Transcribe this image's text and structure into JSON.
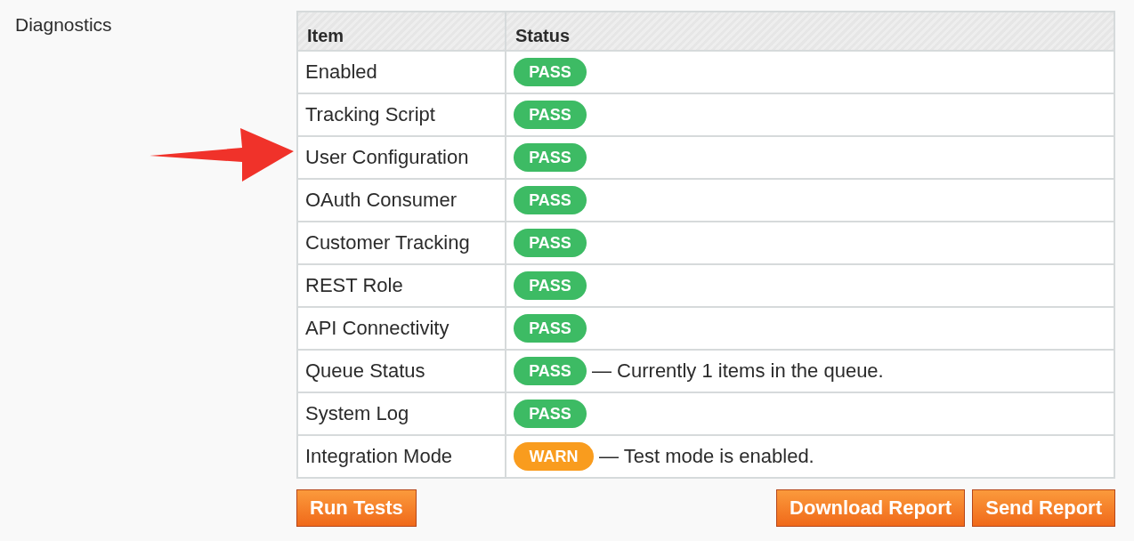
{
  "section_label": "Diagnostics",
  "table": {
    "columns": [
      "Item",
      "Status"
    ],
    "rows": [
      {
        "item": "Enabled",
        "status": {
          "kind": "pass",
          "label": "PASS"
        }
      },
      {
        "item": "Tracking Script",
        "status": {
          "kind": "pass",
          "label": "PASS"
        }
      },
      {
        "item": "User Configuration",
        "status": {
          "kind": "pass",
          "label": "PASS"
        }
      },
      {
        "item": "OAuth Consumer",
        "status": {
          "kind": "pass",
          "label": "PASS"
        }
      },
      {
        "item": "Customer Tracking",
        "status": {
          "kind": "pass",
          "label": "PASS"
        }
      },
      {
        "item": "REST Role",
        "status": {
          "kind": "pass",
          "label": "PASS"
        }
      },
      {
        "item": "API Connectivity",
        "status": {
          "kind": "pass",
          "label": "PASS"
        }
      },
      {
        "item": "Queue Status",
        "status": {
          "kind": "pass",
          "label": "PASS"
        },
        "note": "— Currently 1 items in the queue."
      },
      {
        "item": "System Log",
        "status": {
          "kind": "pass",
          "label": "PASS"
        }
      },
      {
        "item": "Integration Mode",
        "status": {
          "kind": "warn",
          "label": "WARN"
        },
        "note": "— Test mode is enabled."
      }
    ]
  },
  "buttons": {
    "left": [
      "Run Tests"
    ],
    "right": [
      "Download Report",
      "Send Report"
    ]
  }
}
